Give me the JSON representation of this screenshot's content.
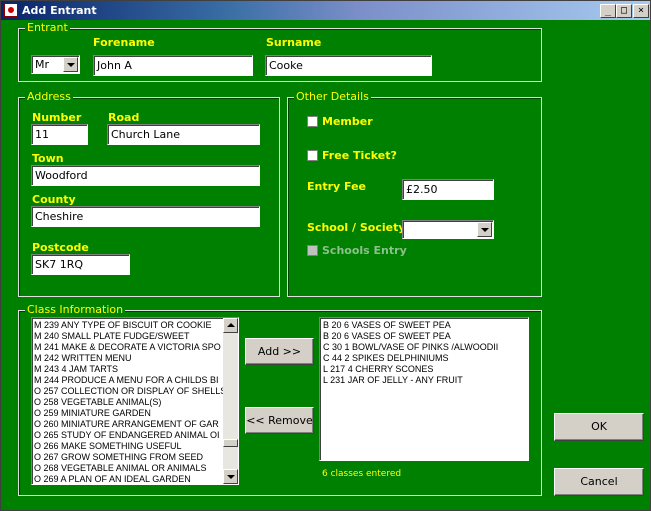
{
  "window": {
    "title": "Add Entrant",
    "minimize": "_",
    "maximize": "□",
    "close": "×"
  },
  "entrant": {
    "legend": "Entrant",
    "forename_label": "Forename",
    "surname_label": "Surname",
    "title_value": "Mr",
    "forename_value": "John A",
    "surname_value": "Cooke"
  },
  "address": {
    "legend": "Address",
    "number_label": "Number",
    "road_label": "Road",
    "town_label": "Town",
    "county_label": "County",
    "postcode_label": "Postcode",
    "number_value": "11",
    "road_value": "Church Lane",
    "town_value": "Woodford",
    "county_value": "Cheshire",
    "postcode_value": "SK7 1RQ"
  },
  "other": {
    "legend": "Other Details",
    "member_label": "Member",
    "free_ticket_label": "Free Ticket?",
    "entry_fee_label": "Entry Fee",
    "entry_fee_value": "£2.50",
    "school_label": "School / Society",
    "school_value": "",
    "schools_entry_label": "Schools Entry"
  },
  "classes": {
    "legend": "Class Information",
    "available": [
      "M  239 ANY TYPE OF BISCUIT OR COOKIE",
      "M  240 SMALL PLATE FUDGE/SWEET",
      "M  241 MAKE & DECORATE A VICTORIA SPO",
      "M  242 WRITTEN MENU",
      "M  243 4 JAM TARTS",
      "M  244 PRODUCE A MENU FOR A CHILDS BI",
      "O  257 COLLECTION OR DISPLAY OF SHELLS",
      "O  258 VEGETABLE ANIMAL(S)",
      "O  259 MINIATURE GARDEN",
      "O  260 MINIATURE ARRANGEMENT OF GAR",
      "O  265 STUDY OF ENDANGERED ANIMAL OI",
      "O  266 MAKE SOMETHING USEFUL",
      "O  267 GROW SOMETHING FROM SEED",
      "O  268 VEGETABLE ANIMAL OR ANIMALS",
      "O  269 A PLAN OF AN IDEAL GARDEN"
    ],
    "selected": [
      "B  20 6 VASES OF SWEET PEA",
      "B  20 6 VASES OF SWEET PEA",
      "C  30 1 BOWL/VASE OF PINKS /ALWOODII",
      "C  44 2 SPIKES DELPHINIUMS",
      "L  217 4 CHERRY SCONES",
      "L  231 JAR OF JELLY - ANY FRUIT"
    ],
    "add_button": "Add >>",
    "remove_button": "<< Remove",
    "count_text": "6 classes entered"
  },
  "actions": {
    "ok": "OK",
    "cancel": "Cancel"
  }
}
